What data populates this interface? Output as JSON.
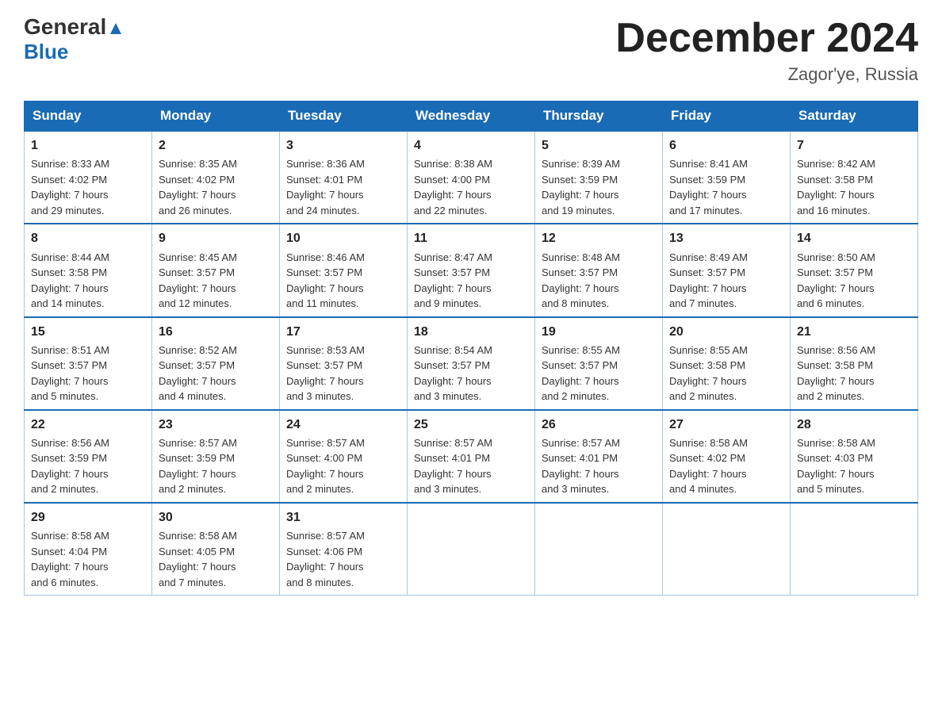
{
  "logo": {
    "general": "General",
    "blue": "Blue",
    "triangle": "▶"
  },
  "title": "December 2024",
  "location": "Zagor'ye, Russia",
  "days_of_week": [
    "Sunday",
    "Monday",
    "Tuesday",
    "Wednesday",
    "Thursday",
    "Friday",
    "Saturday"
  ],
  "weeks": [
    [
      {
        "num": "1",
        "info": "Sunrise: 8:33 AM\nSunset: 4:02 PM\nDaylight: 7 hours\nand 29 minutes."
      },
      {
        "num": "2",
        "info": "Sunrise: 8:35 AM\nSunset: 4:02 PM\nDaylight: 7 hours\nand 26 minutes."
      },
      {
        "num": "3",
        "info": "Sunrise: 8:36 AM\nSunset: 4:01 PM\nDaylight: 7 hours\nand 24 minutes."
      },
      {
        "num": "4",
        "info": "Sunrise: 8:38 AM\nSunset: 4:00 PM\nDaylight: 7 hours\nand 22 minutes."
      },
      {
        "num": "5",
        "info": "Sunrise: 8:39 AM\nSunset: 3:59 PM\nDaylight: 7 hours\nand 19 minutes."
      },
      {
        "num": "6",
        "info": "Sunrise: 8:41 AM\nSunset: 3:59 PM\nDaylight: 7 hours\nand 17 minutes."
      },
      {
        "num": "7",
        "info": "Sunrise: 8:42 AM\nSunset: 3:58 PM\nDaylight: 7 hours\nand 16 minutes."
      }
    ],
    [
      {
        "num": "8",
        "info": "Sunrise: 8:44 AM\nSunset: 3:58 PM\nDaylight: 7 hours\nand 14 minutes."
      },
      {
        "num": "9",
        "info": "Sunrise: 8:45 AM\nSunset: 3:57 PM\nDaylight: 7 hours\nand 12 minutes."
      },
      {
        "num": "10",
        "info": "Sunrise: 8:46 AM\nSunset: 3:57 PM\nDaylight: 7 hours\nand 11 minutes."
      },
      {
        "num": "11",
        "info": "Sunrise: 8:47 AM\nSunset: 3:57 PM\nDaylight: 7 hours\nand 9 minutes."
      },
      {
        "num": "12",
        "info": "Sunrise: 8:48 AM\nSunset: 3:57 PM\nDaylight: 7 hours\nand 8 minutes."
      },
      {
        "num": "13",
        "info": "Sunrise: 8:49 AM\nSunset: 3:57 PM\nDaylight: 7 hours\nand 7 minutes."
      },
      {
        "num": "14",
        "info": "Sunrise: 8:50 AM\nSunset: 3:57 PM\nDaylight: 7 hours\nand 6 minutes."
      }
    ],
    [
      {
        "num": "15",
        "info": "Sunrise: 8:51 AM\nSunset: 3:57 PM\nDaylight: 7 hours\nand 5 minutes."
      },
      {
        "num": "16",
        "info": "Sunrise: 8:52 AM\nSunset: 3:57 PM\nDaylight: 7 hours\nand 4 minutes."
      },
      {
        "num": "17",
        "info": "Sunrise: 8:53 AM\nSunset: 3:57 PM\nDaylight: 7 hours\nand 3 minutes."
      },
      {
        "num": "18",
        "info": "Sunrise: 8:54 AM\nSunset: 3:57 PM\nDaylight: 7 hours\nand 3 minutes."
      },
      {
        "num": "19",
        "info": "Sunrise: 8:55 AM\nSunset: 3:57 PM\nDaylight: 7 hours\nand 2 minutes."
      },
      {
        "num": "20",
        "info": "Sunrise: 8:55 AM\nSunset: 3:58 PM\nDaylight: 7 hours\nand 2 minutes."
      },
      {
        "num": "21",
        "info": "Sunrise: 8:56 AM\nSunset: 3:58 PM\nDaylight: 7 hours\nand 2 minutes."
      }
    ],
    [
      {
        "num": "22",
        "info": "Sunrise: 8:56 AM\nSunset: 3:59 PM\nDaylight: 7 hours\nand 2 minutes."
      },
      {
        "num": "23",
        "info": "Sunrise: 8:57 AM\nSunset: 3:59 PM\nDaylight: 7 hours\nand 2 minutes."
      },
      {
        "num": "24",
        "info": "Sunrise: 8:57 AM\nSunset: 4:00 PM\nDaylight: 7 hours\nand 2 minutes."
      },
      {
        "num": "25",
        "info": "Sunrise: 8:57 AM\nSunset: 4:01 PM\nDaylight: 7 hours\nand 3 minutes."
      },
      {
        "num": "26",
        "info": "Sunrise: 8:57 AM\nSunset: 4:01 PM\nDaylight: 7 hours\nand 3 minutes."
      },
      {
        "num": "27",
        "info": "Sunrise: 8:58 AM\nSunset: 4:02 PM\nDaylight: 7 hours\nand 4 minutes."
      },
      {
        "num": "28",
        "info": "Sunrise: 8:58 AM\nSunset: 4:03 PM\nDaylight: 7 hours\nand 5 minutes."
      }
    ],
    [
      {
        "num": "29",
        "info": "Sunrise: 8:58 AM\nSunset: 4:04 PM\nDaylight: 7 hours\nand 6 minutes."
      },
      {
        "num": "30",
        "info": "Sunrise: 8:58 AM\nSunset: 4:05 PM\nDaylight: 7 hours\nand 7 minutes."
      },
      {
        "num": "31",
        "info": "Sunrise: 8:57 AM\nSunset: 4:06 PM\nDaylight: 7 hours\nand 8 minutes."
      },
      {
        "num": "",
        "info": ""
      },
      {
        "num": "",
        "info": ""
      },
      {
        "num": "",
        "info": ""
      },
      {
        "num": "",
        "info": ""
      }
    ]
  ]
}
